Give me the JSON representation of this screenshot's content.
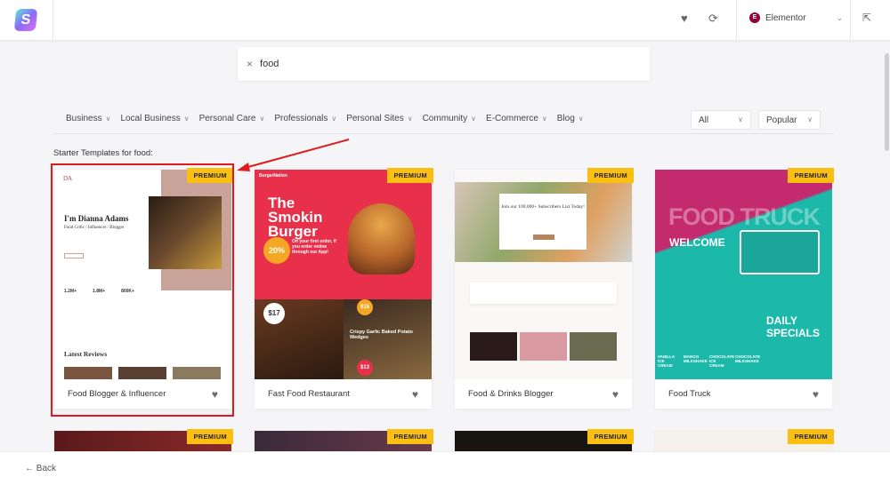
{
  "header": {
    "logo": "S",
    "builder_label": "Elementor",
    "builder_badge": "E",
    "icons": [
      "heart-icon",
      "refresh-icon",
      "chevron-down-icon",
      "external-link-icon"
    ]
  },
  "search": {
    "value": "food",
    "clear_icon": "×"
  },
  "filters": [
    "Business",
    "Local Business",
    "Personal Care",
    "Professionals",
    "Personal Sites",
    "Community",
    "E-Commerce",
    "Blog"
  ],
  "type_select": "All",
  "sort_select": "Popular",
  "results_label": "Starter Templates for food:",
  "cards": [
    {
      "title": "Food Blogger & Influencer",
      "badge": "PREMIUM",
      "thumb": {
        "heading": "I'm Dianna Adams",
        "sub": "Food Critic / Influencer / Blogger",
        "stats": [
          "1.2M+",
          "1.8M+",
          "800K+"
        ],
        "section": "Latest Reviews",
        "brand": "DA"
      }
    },
    {
      "title": "Fast Food Restaurant",
      "badge": "PREMIUM",
      "thumb": {
        "brand": "BurgerNation",
        "heading": "The Smokin Burger",
        "promo": "20%",
        "promo_text": "On your first order, if you order online through our App!",
        "price1": "$17",
        "price2": "$15",
        "price3": "$13",
        "item": "Crispy Garlic Baked Potato Wedges"
      }
    },
    {
      "title": "Food & Drinks Blogger",
      "badge": "PREMIUM",
      "thumb": {
        "heading": "Join our 100,000+ Subscribers List Today!"
      }
    },
    {
      "title": "Food Truck",
      "badge": "PREMIUM",
      "thumb": {
        "heading": "FOOD TRUCK",
        "welcome": "WELCOME",
        "specials": "DAILY SPECIALS",
        "items": [
          "VANILLA ICE CREAM",
          "MANGO MILKSHAKE",
          "CHOCOLATE ICE CREAM",
          "CHOCOLATE MILKSHAKE"
        ]
      }
    },
    {
      "badge": "PREMIUM"
    },
    {
      "badge": "PREMIUM"
    },
    {
      "badge": "PREMIUM"
    },
    {
      "badge": "PREMIUM"
    }
  ],
  "footer": {
    "back_label": "Back",
    "back_icon": "←"
  },
  "colors": {
    "premium": "#fbbf14",
    "highlight": "#e0191e",
    "elementor": "#92003b"
  }
}
